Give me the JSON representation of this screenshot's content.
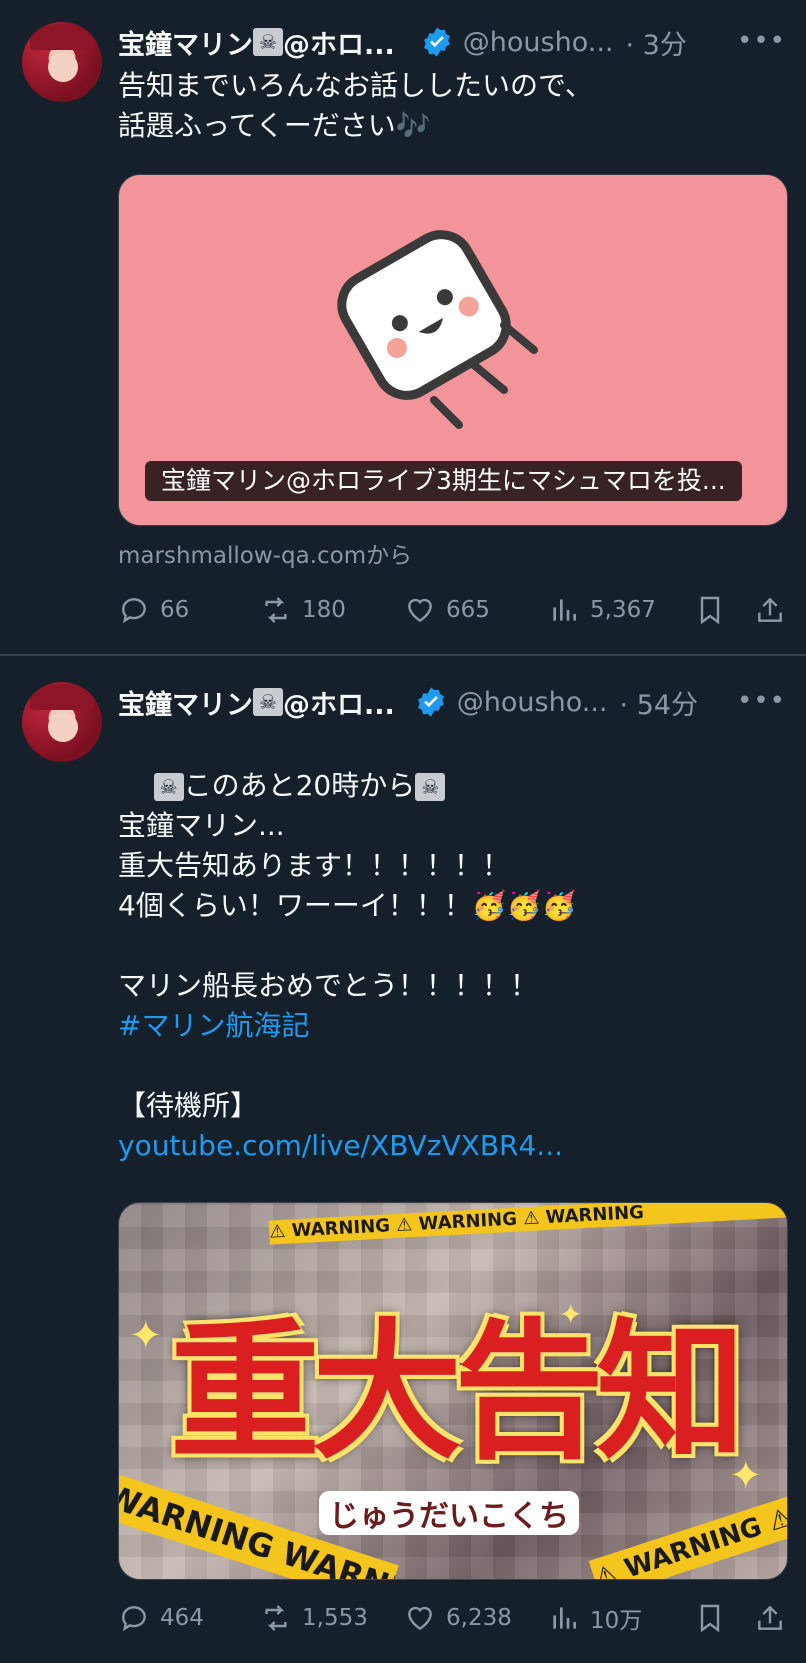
{
  "colors": {
    "background": "#15202b",
    "text": "#f7f9f9",
    "muted": "#8b98a5",
    "link": "#1d9bf0",
    "verified": "#1d9bf0",
    "marshmallow_card": "#f29499"
  },
  "tweets": [
    {
      "author_name": "宝鐘マリン",
      "author_suffix": "@ホロ...",
      "handle": "@housho...",
      "time": "· 3分",
      "more": "•••",
      "text": "告知までいろんなお話ししたいので、\n話題ふってくーださい🎶",
      "card_caption": "宝鐘マリン@ホロライブ3期生にマシュマロを投...",
      "card_source": "marshmallow-qa.comから",
      "stats": {
        "replies": "66",
        "reposts": "180",
        "likes": "665",
        "views": "5,367"
      }
    },
    {
      "author_name": "宝鐘マリン",
      "author_suffix": "@ホロ...",
      "handle": "@housho...",
      "time": "· 54分",
      "more": "•••",
      "line1": "このあと20時から",
      "text_block": "宝鐘マリン...\n重大告知あります！！！！！！\n4個くらい！ワーーイ！！！🥳🥳🥳\n\nマリン船長おめでとう！！！！！",
      "hashtag": "#マリン航海記",
      "waiting_label": "【待機所】",
      "url": "youtube.com/live/XBVzVXBR4...",
      "image_title": "重大告知",
      "image_subtitle": "じゅうだいこくち",
      "image_tape": "WARNING",
      "stats": {
        "replies": "464",
        "reposts": "1,553",
        "likes": "6,238",
        "views": "10万"
      }
    }
  ]
}
